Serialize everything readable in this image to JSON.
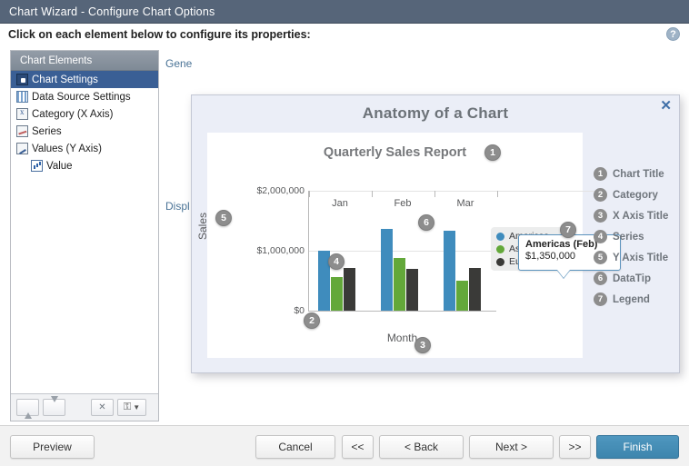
{
  "window": {
    "title": "Chart Wizard - Configure Chart Options"
  },
  "instruction": {
    "text": "Click on each element below to configure its properties:",
    "help_glyph": "?"
  },
  "sidebar": {
    "header": "Chart Elements",
    "items": [
      {
        "label": "Chart Settings",
        "icon": "settings-icon",
        "selected": true,
        "indent": false
      },
      {
        "label": "Data Source Settings",
        "icon": "grid-icon",
        "selected": false,
        "indent": false
      },
      {
        "label": "Category (X Axis)",
        "icon": "x-axis-icon",
        "selected": false,
        "indent": false
      },
      {
        "label": "Series",
        "icon": "series-icon",
        "selected": false,
        "indent": false
      },
      {
        "label": "Values (Y Axis)",
        "icon": "y-axis-icon",
        "selected": false,
        "indent": false
      },
      {
        "label": "Value",
        "icon": "value-bars-icon",
        "selected": false,
        "indent": true
      }
    ],
    "toolbar": {
      "move_up": "▲",
      "move_down": "▼",
      "remove": "✕",
      "add": "▼"
    }
  },
  "background_labels": {
    "general": "Gene",
    "display": "Displ"
  },
  "overlay": {
    "title": "Anatomy of a Chart",
    "close_glyph": "✕",
    "legend_items": [
      {
        "num": "1",
        "label": "Chart Title"
      },
      {
        "num": "2",
        "label": "Category"
      },
      {
        "num": "3",
        "label": "X Axis Title"
      },
      {
        "num": "4",
        "label": "Series"
      },
      {
        "num": "5",
        "label": "Y Axis Title"
      },
      {
        "num": "6",
        "label": "DataTip"
      },
      {
        "num": "7",
        "label": "Legend"
      }
    ],
    "callouts": [
      {
        "num": "1",
        "target": "chart-title"
      },
      {
        "num": "2",
        "target": "category"
      },
      {
        "num": "3",
        "target": "x-axis-title"
      },
      {
        "num": "4",
        "target": "series"
      },
      {
        "num": "5",
        "target": "y-axis-title"
      },
      {
        "num": "6",
        "target": "datatip"
      },
      {
        "num": "7",
        "target": "legend"
      }
    ],
    "datatip": {
      "line1": "Americas (Feb)",
      "line2": "$1,350,000"
    }
  },
  "chart_data": {
    "type": "bar",
    "title": "Quarterly Sales Report",
    "xlabel": "Month",
    "ylabel": "Sales",
    "categories": [
      "Jan",
      "Feb",
      "Mar"
    ],
    "ytick_labels": [
      "$2,000,000",
      "$1,000,000",
      "$0"
    ],
    "ytick_values": [
      2000000,
      1000000,
      0
    ],
    "ylim": [
      0,
      2000000
    ],
    "grid": true,
    "legend_position": "right",
    "series": [
      {
        "name": "Americas",
        "color": "#3f8cbd",
        "values": [
          1000000,
          1350000,
          1320000
        ]
      },
      {
        "name": "Asia Pacific",
        "color": "#63a83a",
        "values": [
          560000,
          880000,
          500000
        ]
      },
      {
        "name": "Europe",
        "color": "#3a3a38",
        "values": [
          700000,
          690000,
          710000
        ]
      }
    ]
  },
  "footer": {
    "preview": "Preview",
    "cancel": "Cancel",
    "first": "<<",
    "back": "< Back",
    "next": "Next >",
    "last": ">>",
    "finish": "Finish"
  }
}
